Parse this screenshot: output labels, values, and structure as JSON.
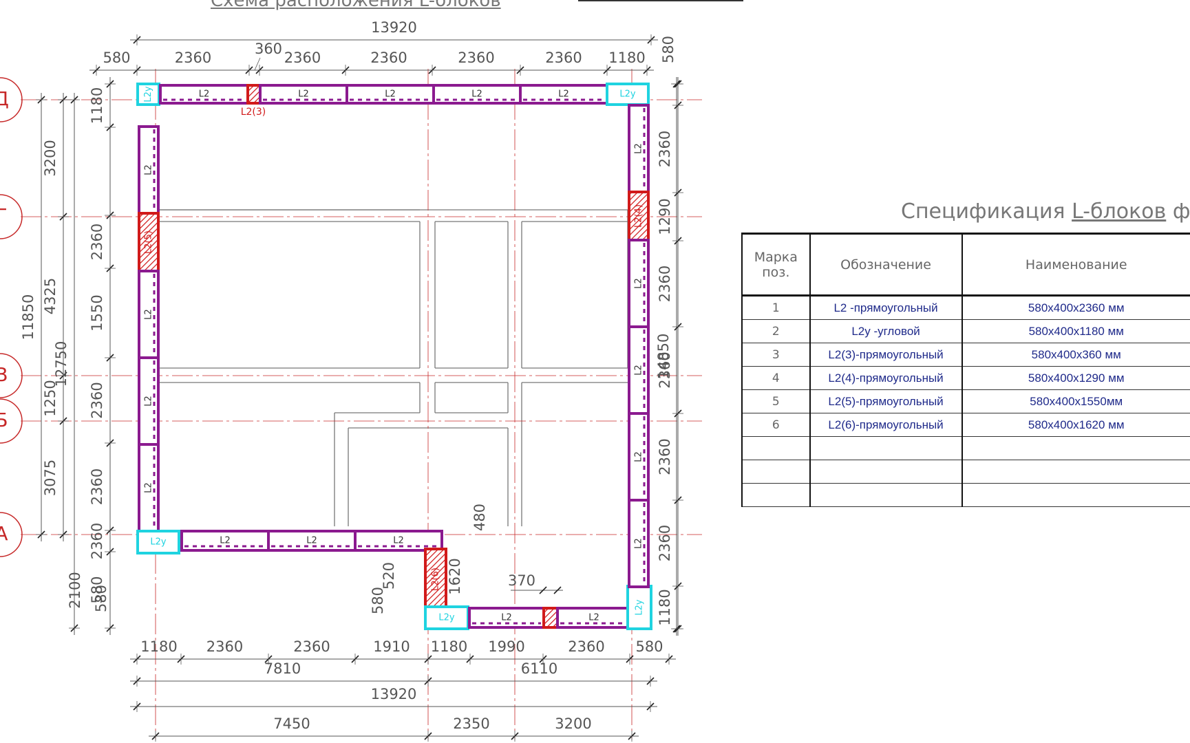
{
  "plan": {
    "title": "Схема расположения L-блоков",
    "axes": [
      "Д",
      "Г",
      "В",
      "Б",
      "А"
    ],
    "dims": {
      "top_overall": "13920",
      "top_row": [
        "580",
        "2360",
        "2360",
        "2360",
        "2360",
        "2360",
        "1180"
      ],
      "top_small": "360",
      "top_right": "580",
      "bottom_row": [
        "1180",
        "2360",
        "2360",
        "1910",
        "1180",
        "1990",
        "2360",
        "580"
      ],
      "bottom_row2": [
        "7810",
        "6110"
      ],
      "bottom_overall": "13920",
      "bottom_axes": [
        "7450",
        "2350",
        "3200"
      ],
      "left_outer": "11850",
      "left_outer2": "12750",
      "left_axes": [
        "3200",
        "4325",
        "1250",
        "3075",
        "2100"
      ],
      "left_blocks": [
        "1180",
        "2360",
        "1550",
        "2360",
        "2360",
        "2360",
        "580"
      ],
      "right_blocks": [
        "580",
        "2360",
        "1290",
        "2360",
        "2360",
        "2360",
        "2360",
        "1180"
      ],
      "right_overall": "14850",
      "notch": [
        "480",
        "1620",
        "520",
        "580",
        "370"
      ]
    },
    "block_labels": {
      "l2": "L2",
      "l2y": "L2у",
      "l2_3": "L2(3)",
      "l2_4": "L2(4)",
      "l2_5": "L2(5)",
      "l2_6": "L2(6)"
    },
    "colors": {
      "block": "#8b1a8f",
      "corner": "#1fd3e0",
      "special": "#d11a1a",
      "dim": "#555555",
      "axis": "#c62828",
      "wall": "#777777"
    }
  },
  "spec": {
    "title_prefix": "Спецификация ",
    "title_underlined": "L-блоков",
    "title_suffix": " фунд",
    "headers": [
      "Марка поз.",
      "Обозначение",
      "Наименование"
    ],
    "rows": [
      {
        "pos": "1",
        "code": "L2 -прямоугольный",
        "name": "580х400х2360 мм"
      },
      {
        "pos": "2",
        "code": "L2у -угловой",
        "name": "580х400х1180 мм"
      },
      {
        "pos": "3",
        "code": "L2(3)-прямоугольный",
        "name": "580х400х360 мм"
      },
      {
        "pos": "4",
        "code": "L2(4)-прямоугольный",
        "name": "580х400х1290 мм"
      },
      {
        "pos": "5",
        "code": "L2(5)-прямоугольный",
        "name": "580х400х1550мм"
      },
      {
        "pos": "6",
        "code": "L2(6)-прямоугольный",
        "name": "580х400х1620 мм"
      },
      {
        "pos": "",
        "code": "",
        "name": ""
      },
      {
        "pos": "",
        "code": "",
        "name": ""
      },
      {
        "pos": "",
        "code": "",
        "name": ""
      }
    ]
  }
}
